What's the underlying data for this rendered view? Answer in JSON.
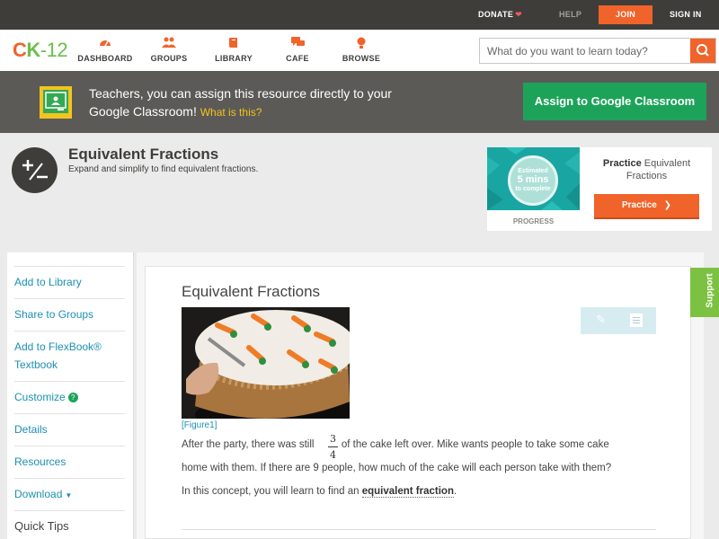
{
  "topbar": {
    "donate": "DONATE",
    "help": "HELP",
    "join": "JOIN",
    "signin": "SIGN IN"
  },
  "logo": {
    "c": "C",
    "k": "K",
    "n": "-12"
  },
  "nav": [
    {
      "label": "DASHBOARD",
      "icon": "dashboard-icon"
    },
    {
      "label": "GROUPS",
      "icon": "groups-icon"
    },
    {
      "label": "LIBRARY",
      "icon": "library-icon"
    },
    {
      "label": "CAFE",
      "icon": "cafe-icon"
    },
    {
      "label": "BROWSE",
      "icon": "browse-icon"
    }
  ],
  "search": {
    "placeholder": "What do you want to learn today?"
  },
  "banner": {
    "text": "Teachers, you can assign this resource directly to your Google Classroom!",
    "link": "What is this?",
    "button": "Assign to Google Classroom"
  },
  "concept": {
    "title": "Equivalent Fractions",
    "subtitle": "Expand and simplify to find equivalent fractions."
  },
  "practice": {
    "estimated": "Estimated",
    "mins": "5 mins",
    "to_complete": "to complete",
    "progress": "PROGRESS",
    "label_bold": "Practice",
    "label_rest": "Equivalent Fractions",
    "button": "Practice"
  },
  "sidebar": {
    "items": [
      {
        "label": "Add to Library"
      },
      {
        "label": "Share to Groups"
      },
      {
        "label": "Add to FlexBook® Textbook"
      },
      {
        "label": "Customize"
      },
      {
        "label": "Details"
      },
      {
        "label": "Resources"
      },
      {
        "label": "Download"
      },
      {
        "label": "Quick Tips"
      }
    ]
  },
  "article": {
    "title": "Equivalent Fractions",
    "figure_link": "[Figure1]",
    "para1_before": "After the party, there was still",
    "fraction_num": "3",
    "fraction_den": "4",
    "para1_after": "of the cake left over. Mike wants people to take some cake",
    "para1_line2": "home with them. If there are 9 people, how much of the cake will each person take with them?",
    "para2_before": "In this concept, you will learn to find an",
    "para2_keyword": "equivalent fraction",
    "para2_after": "."
  },
  "support": "Support",
  "colors": {
    "brand_orange": "#f0632a",
    "brand_green": "#6abf4b",
    "classroom_green": "#1da359",
    "link_blue": "#1c8fb1"
  }
}
